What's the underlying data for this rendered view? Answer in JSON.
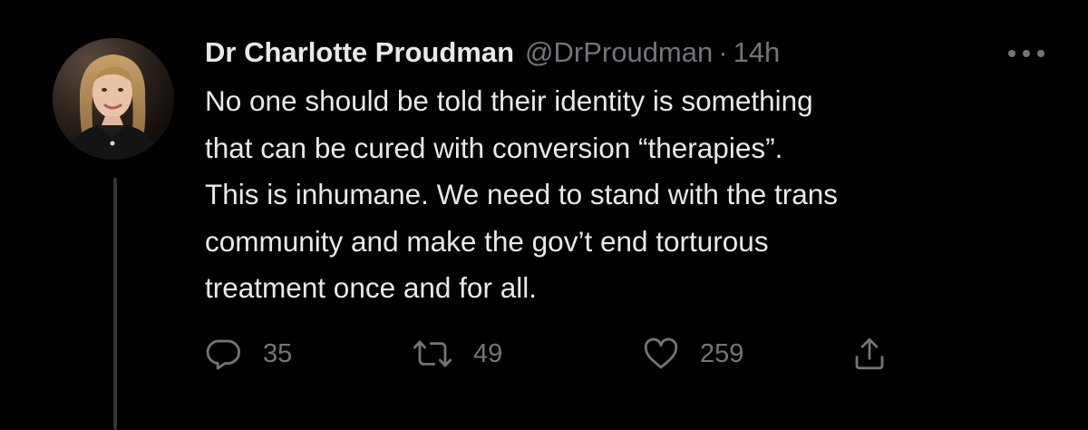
{
  "tweet": {
    "author": {
      "display_name": "Dr Charlotte Proudman",
      "handle": "@DrProudman",
      "separator": "·",
      "time": "14h"
    },
    "text_lines": [
      "No one should be told their identity is something",
      "that can be cured with conversion “therapies”.",
      "This is inhumane. We need to stand with the trans",
      "community and make the gov’t end torturous",
      "treatment once and for all."
    ],
    "actions": {
      "reply": {
        "icon": "reply-icon",
        "count": "35"
      },
      "retweet": {
        "icon": "retweet-icon",
        "count": "49"
      },
      "like": {
        "icon": "heart-icon",
        "count": "259"
      },
      "share": {
        "icon": "share-icon"
      }
    },
    "more_icon": "more-options-icon"
  },
  "colors": {
    "background": "#000000",
    "primary_text": "#e7e9ea",
    "secondary_text": "#71767b",
    "thread_line": "#333639"
  }
}
